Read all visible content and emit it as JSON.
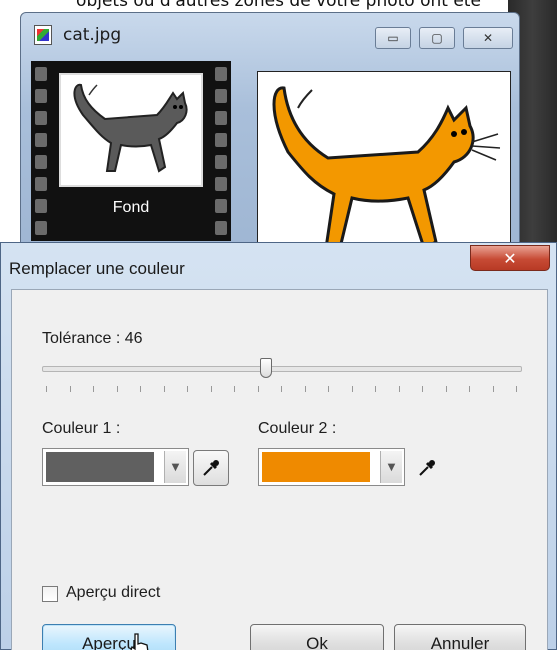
{
  "top_caption": "objets ou d'autres zones de votre photo ont été",
  "background_window": {
    "title": "cat.jpg",
    "min_glyph": "▭",
    "max_glyph": "▢",
    "close_glyph": "✕",
    "thumbnail_label": "Fond"
  },
  "dialog": {
    "title": "Remplacer une couleur",
    "close_glyph": "✕",
    "tolerance_label": "Tolérance : 46",
    "tolerance_value": 46,
    "color1_label": "Couleur 1 :",
    "color2_label": "Couleur 2 :",
    "color1": "#606060",
    "color2": "#ef8a00",
    "live_preview_label": "Aperçu direct",
    "live_preview_checked": false,
    "preview_button": "Aperçu",
    "ok_button": "Ok",
    "cancel_button": "Annuler"
  }
}
